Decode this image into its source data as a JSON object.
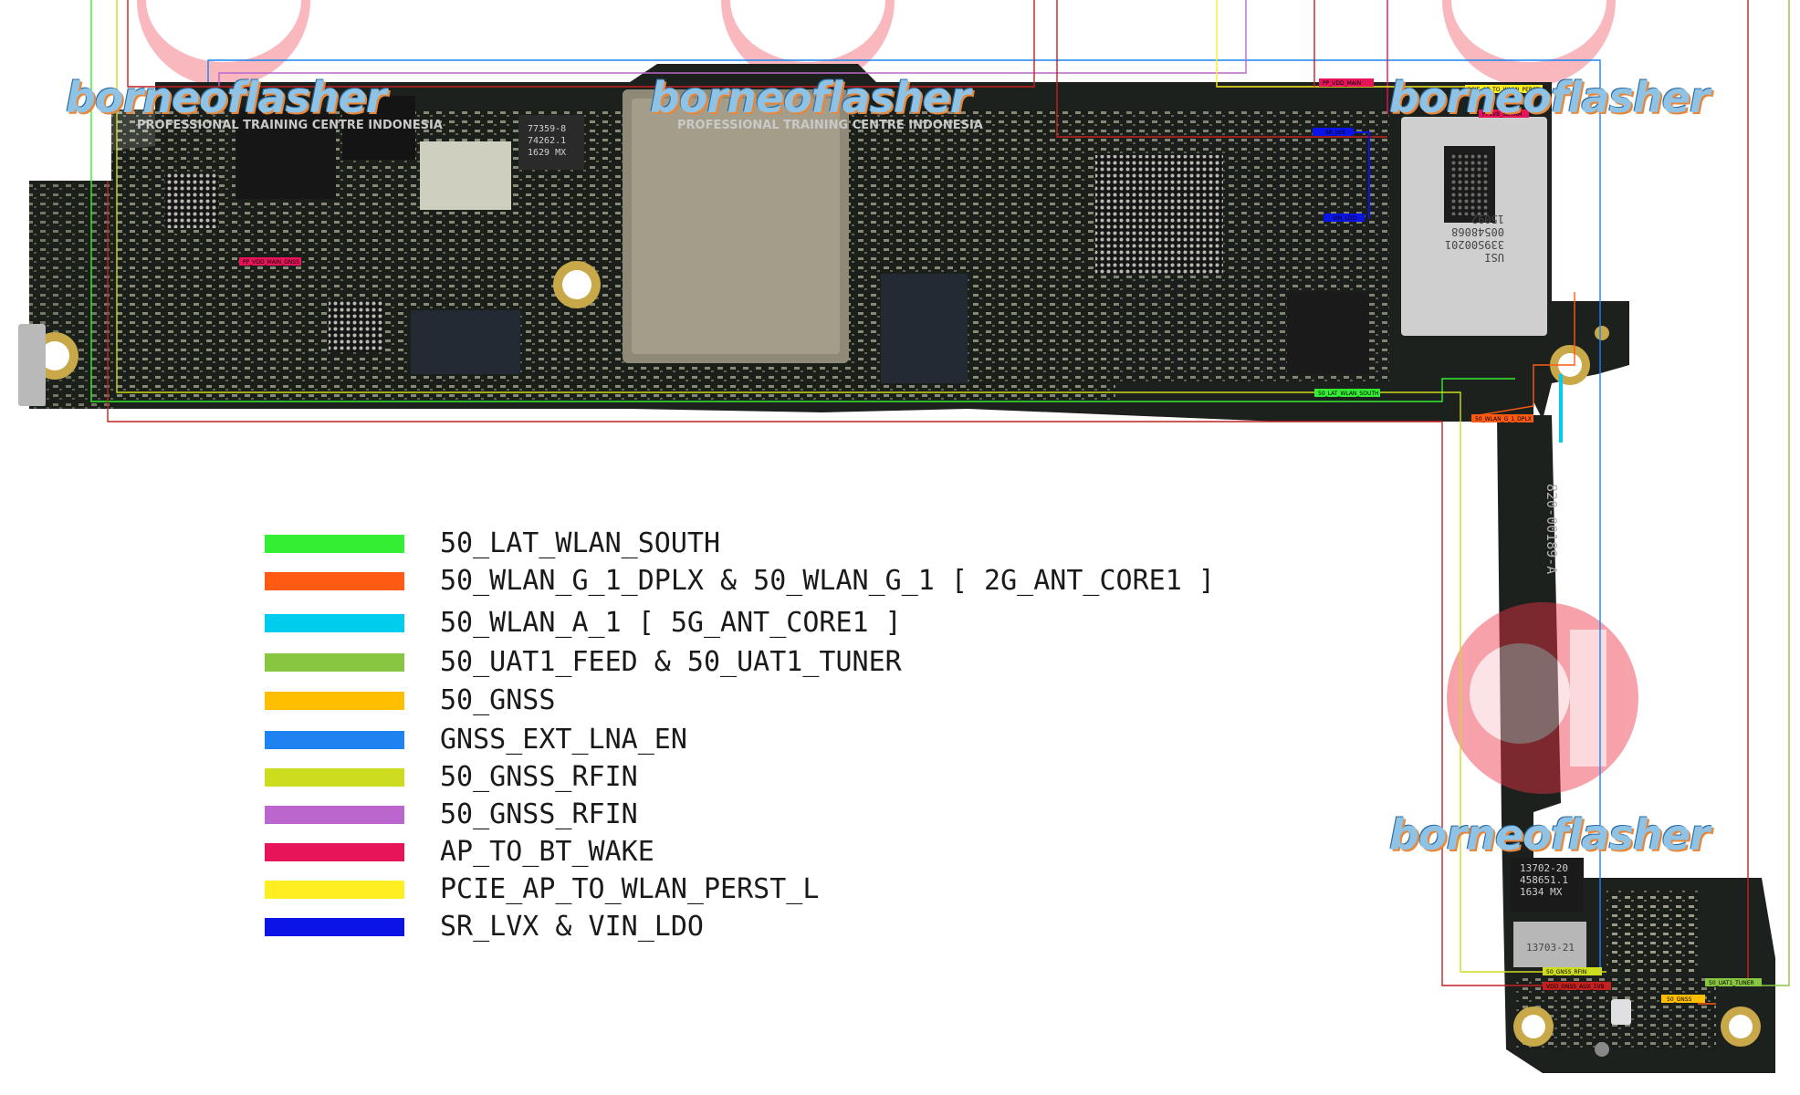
{
  "watermarks": {
    "brand": "borneoflasher",
    "tagline": "PROFESSIONAL TRAINING CENTRE INDONESIA"
  },
  "legend": [
    {
      "label": "50_LAT_WLAN_SOUTH",
      "color": "#33ee33"
    },
    {
      "label": "50_WLAN_G_1_DPLX & 50_WLAN_G_1 [ 2G_ANT_CORE1 ]",
      "color": "#ff5a14"
    },
    {
      "label": "50_WLAN_A_1 [ 5G_ANT_CORE1 ]",
      "color": "#00ccee"
    },
    {
      "label": "50_UAT1_FEED & 50_UAT1_TUNER",
      "color": "#88c540"
    },
    {
      "label": "50_GNSS",
      "color": "#ffbf00"
    },
    {
      "label": "GNSS_EXT_LNA_EN",
      "color": "#1e82f0"
    },
    {
      "label": "50_GNSS_RFIN",
      "color": "#cddc1e"
    },
    {
      "label": "50_GNSS_RFIN",
      "color": "#bb66cc"
    },
    {
      "label": "AP_TO_BT_WAKE",
      "color": "#e8145a"
    },
    {
      "label": "PCIE_AP_TO_WLAN_PERST_L",
      "color": "#ffee22"
    },
    {
      "label": "SR_LVX & VIN_LDO",
      "color": "#0a14e6"
    }
  ],
  "board_labels": {
    "lat_wlan_south": "50_LAT_WLAN_SOUTH",
    "wlan_g1_dplx": "50_WLAN_G_1_DPLX",
    "gnss_rfin": "50_GNSS_RFIN",
    "vdd_gnss_aux": "VDD_GNSS_AUX_1V8",
    "uat1_tuner": "50_UAT1_TUNER",
    "gnss": "50_GNSS",
    "pp_vdd_main": "PP_VDD_MAIN",
    "pcie_perst": "PCIE_AP_TO_WLAN_PERST_L",
    "pp1v8_sdram": "PP1V8_SDRAM",
    "sr_lvx": "SR_LVX",
    "vin_ldo": "VIN_LDO",
    "pp_vdd_main_gnss": "PP_VDD_MAIN_GNSS",
    "board_part": "820-00189-A"
  },
  "chip_text": {
    "pa_line1": "77359-8",
    "pa_line2": "74262.1",
    "pa_line3": "1629 MX",
    "wifi_line1": "USI",
    "wifi_line2": "339S00201",
    "wifi_line3": "00548068",
    "wifi_line4": "15092",
    "tail_chip1a": "13702-20",
    "tail_chip1b": "458651.1",
    "tail_chip1c": "1634 MX",
    "tail_chip2": "13703-21"
  }
}
